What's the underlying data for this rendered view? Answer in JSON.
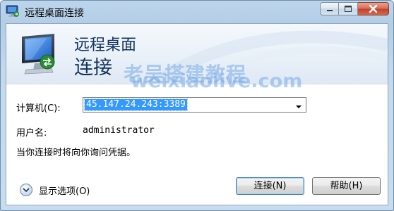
{
  "window": {
    "title": "远程桌面连接"
  },
  "banner": {
    "line1": "远程桌面",
    "line2": "连接"
  },
  "watermark": {
    "text": "老吴搭建教程",
    "url": "weixiaolive.com"
  },
  "form": {
    "computer_label": "计算机(C):",
    "computer_value": "45.147.24.243:3389",
    "user_label": "用户名:",
    "user_value": "administrator",
    "hint": "当你连接时将向你询问凭据。"
  },
  "footer": {
    "options_label": "显示选项(O)",
    "connect_label": "连接(N)",
    "help_label": "帮助(H)"
  },
  "icons": {
    "app": "remote-desktop-icon",
    "banner": "monitor-icon",
    "options": "chevron-down-circle-icon",
    "dropdown": "triangle-down-icon"
  },
  "colors": {
    "accent": "#3399ff",
    "banner_text": "#13325b",
    "watermark": "#78aae6",
    "close_button": "#c3432a"
  }
}
